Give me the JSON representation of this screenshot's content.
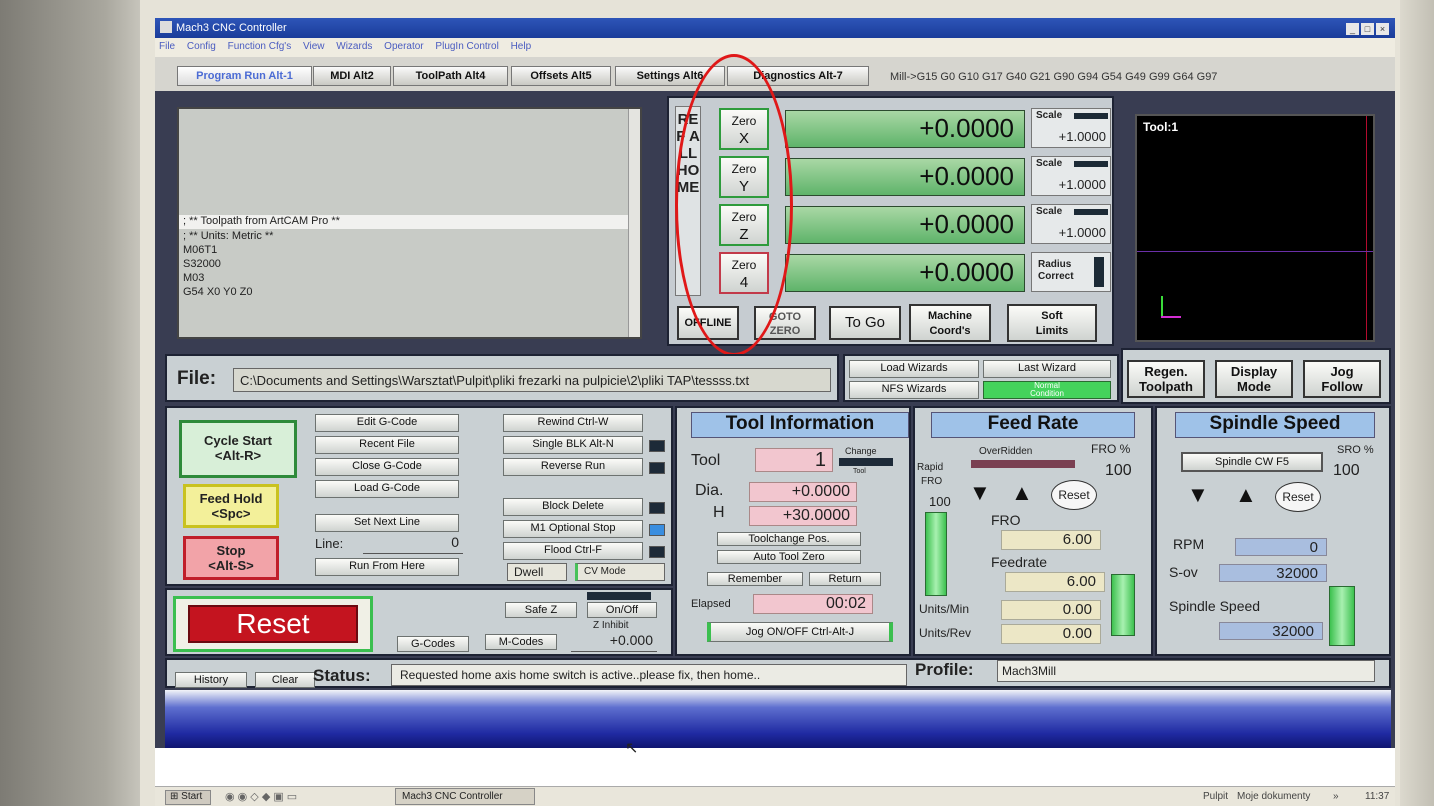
{
  "window": {
    "title": "Mach3 CNC Controller"
  },
  "menu": [
    "File",
    "Config",
    "Function Cfg's",
    "View",
    "Wizards",
    "Operator",
    "PlugIn Control",
    "Help"
  ],
  "tabs": [
    "Program Run Alt-1",
    "MDI Alt2",
    "ToolPath Alt4",
    "Offsets Alt5",
    "Settings Alt6",
    "Diagnostics Alt-7"
  ],
  "gcode_modes": "Mill->G15  G0 G10 G17 G40 G21 G90 G94 G54 G49 G99 G64 G97",
  "gcode_lines": [
    "; ** Toolpath from ArtCAM Pro **",
    "; ** Units: Metric **",
    "M06T1",
    "S32000",
    "M03",
    "G54 X0 Y0 Z0"
  ],
  "ref_all_home": "REF ALL HOME",
  "axes": [
    {
      "zero_top": "Zero",
      "zero_axis": "X",
      "dro": "+0.0000",
      "scale_label": "Scale",
      "scale_value": "+1.0000"
    },
    {
      "zero_top": "Zero",
      "zero_axis": "Y",
      "dro": "+0.0000",
      "scale_label": "Scale",
      "scale_value": "+1.0000"
    },
    {
      "zero_top": "Zero",
      "zero_axis": "Z",
      "dro": "+0.0000",
      "scale_label": "Scale",
      "scale_value": "+1.0000"
    },
    {
      "zero_top": "Zero",
      "zero_axis": "4",
      "dro": "+0.0000"
    }
  ],
  "radius_correct": [
    "Radius",
    "Correct"
  ],
  "dro_buttons": {
    "offline": "OFFLINE",
    "goto_zero": [
      "GOTO",
      "ZERO"
    ],
    "to_go": "To Go",
    "machine_coords": [
      "Machine",
      "Coord's"
    ],
    "soft_limits": [
      "Soft",
      "Limits"
    ]
  },
  "toolpath": {
    "tool_label": "Tool:1"
  },
  "file": {
    "label": "File:",
    "path": "C:\\Documents and Settings\\Warsztat\\Pulpit\\pliki frezarki na pulpicie\\2\\pliki TAP\\tessss.txt"
  },
  "wizards": {
    "load": "Load Wizards",
    "last": "Last Wizard",
    "nfs": "NFS Wizards",
    "normal_condition": [
      "Normal",
      "Condition"
    ]
  },
  "view_buttons": {
    "regen": [
      "Regen.",
      "Toolpath"
    ],
    "display_mode": [
      "Display",
      "Mode"
    ],
    "jog_follow": [
      "Jog",
      "Follow"
    ]
  },
  "cycle": {
    "start": [
      "Cycle Start",
      "<Alt-R>"
    ],
    "feed_hold": [
      "Feed Hold",
      "<Spc>"
    ],
    "stop": [
      "Stop",
      "<Alt-S>"
    ],
    "reset": "Reset"
  },
  "file_buttons": [
    "Edit G-Code",
    "Recent File",
    "Close G-Code",
    "Load G-Code",
    "Set Next Line",
    "Run From Here"
  ],
  "line": {
    "label": "Line:",
    "value": "0"
  },
  "run_buttons": [
    "Rewind Ctrl-W",
    "Single BLK Alt-N",
    "Reverse Run",
    "Block Delete",
    "M1 Optional Stop",
    "Flood Ctrl-F"
  ],
  "dwell": "Dwell",
  "cv_mode": "CV Mode",
  "safe_z": {
    "button": "Safe Z",
    "onoff": "On/Off",
    "z_inhibit": "Z Inhibit",
    "value": "+0.000"
  },
  "gcodes_button": "G-Codes",
  "mcodes_button": "M-Codes",
  "tool_info": {
    "title": "Tool Information",
    "tool_label": "Tool",
    "tool_value": "1",
    "change": "Change",
    "change_sub": "Tool",
    "dia_label": "Dia.",
    "dia_value": "+0.0000",
    "h_label": "H",
    "h_value": "+30.0000",
    "toolchange_pos": "Toolchange Pos.",
    "auto_tool_zero": "Auto Tool Zero",
    "remember": "Remember",
    "return": "Return",
    "elapsed_label": "Elapsed",
    "elapsed_value": "00:02",
    "jog_toggle": "Jog ON/OFF Ctrl-Alt-J"
  },
  "feed_rate": {
    "title": "Feed Rate",
    "overridden": "OverRidden",
    "fro_pct_label": "FRO %",
    "fro_pct_value": "100",
    "rapid_label": "Rapid",
    "rapid_fro": "FRO",
    "rapid_value": "100",
    "reset": "Reset",
    "fro_label": "FRO",
    "fro_value": "6.00",
    "feedrate_label": "Feedrate",
    "feedrate_value": "6.00",
    "units_min_label": "Units/Min",
    "units_min_value": "0.00",
    "units_rev_label": "Units/Rev",
    "units_rev_value": "0.00"
  },
  "spindle": {
    "title": "Spindle Speed",
    "cw_button": "Spindle CW F5",
    "sro_label": "SRO %",
    "sro_value": "100",
    "reset": "Reset",
    "rpm_label": "RPM",
    "rpm_value": "0",
    "sov_label": "S-ov",
    "sov_value": "32000",
    "speed_label": "Spindle Speed",
    "speed_value": "32000"
  },
  "status": {
    "history": "History",
    "clear": "Clear",
    "label": "Status:",
    "text": "Requested home axis home switch is active..please fix, then home..",
    "profile_label": "Profile:",
    "profile_value": "Mach3Mill"
  },
  "taskbar": {
    "start": "Start",
    "task": "Mach3 CNC Controller",
    "tray": [
      "Pulpit",
      "Moje dokumenty",
      "11:37"
    ]
  }
}
